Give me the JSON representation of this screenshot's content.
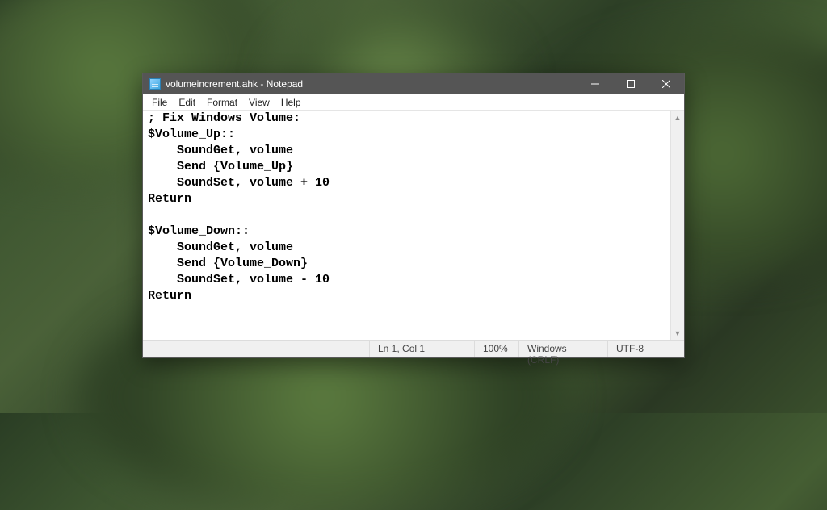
{
  "titlebar": {
    "title": "volumeincrement.ahk - Notepad"
  },
  "menubar": {
    "items": [
      "File",
      "Edit",
      "Format",
      "View",
      "Help"
    ]
  },
  "editor": {
    "content": "; Fix Windows Volume:\n$Volume_Up::\n    SoundGet, volume\n    Send {Volume_Up}\n    SoundSet, volume + 10\nReturn\n\n$Volume_Down::\n    SoundGet, volume\n    Send {Volume_Down}\n    SoundSet, volume - 10\nReturn"
  },
  "statusbar": {
    "position": "Ln 1, Col 1",
    "zoom": "100%",
    "line_ending": "Windows (CRLF)",
    "encoding": "UTF-8"
  }
}
